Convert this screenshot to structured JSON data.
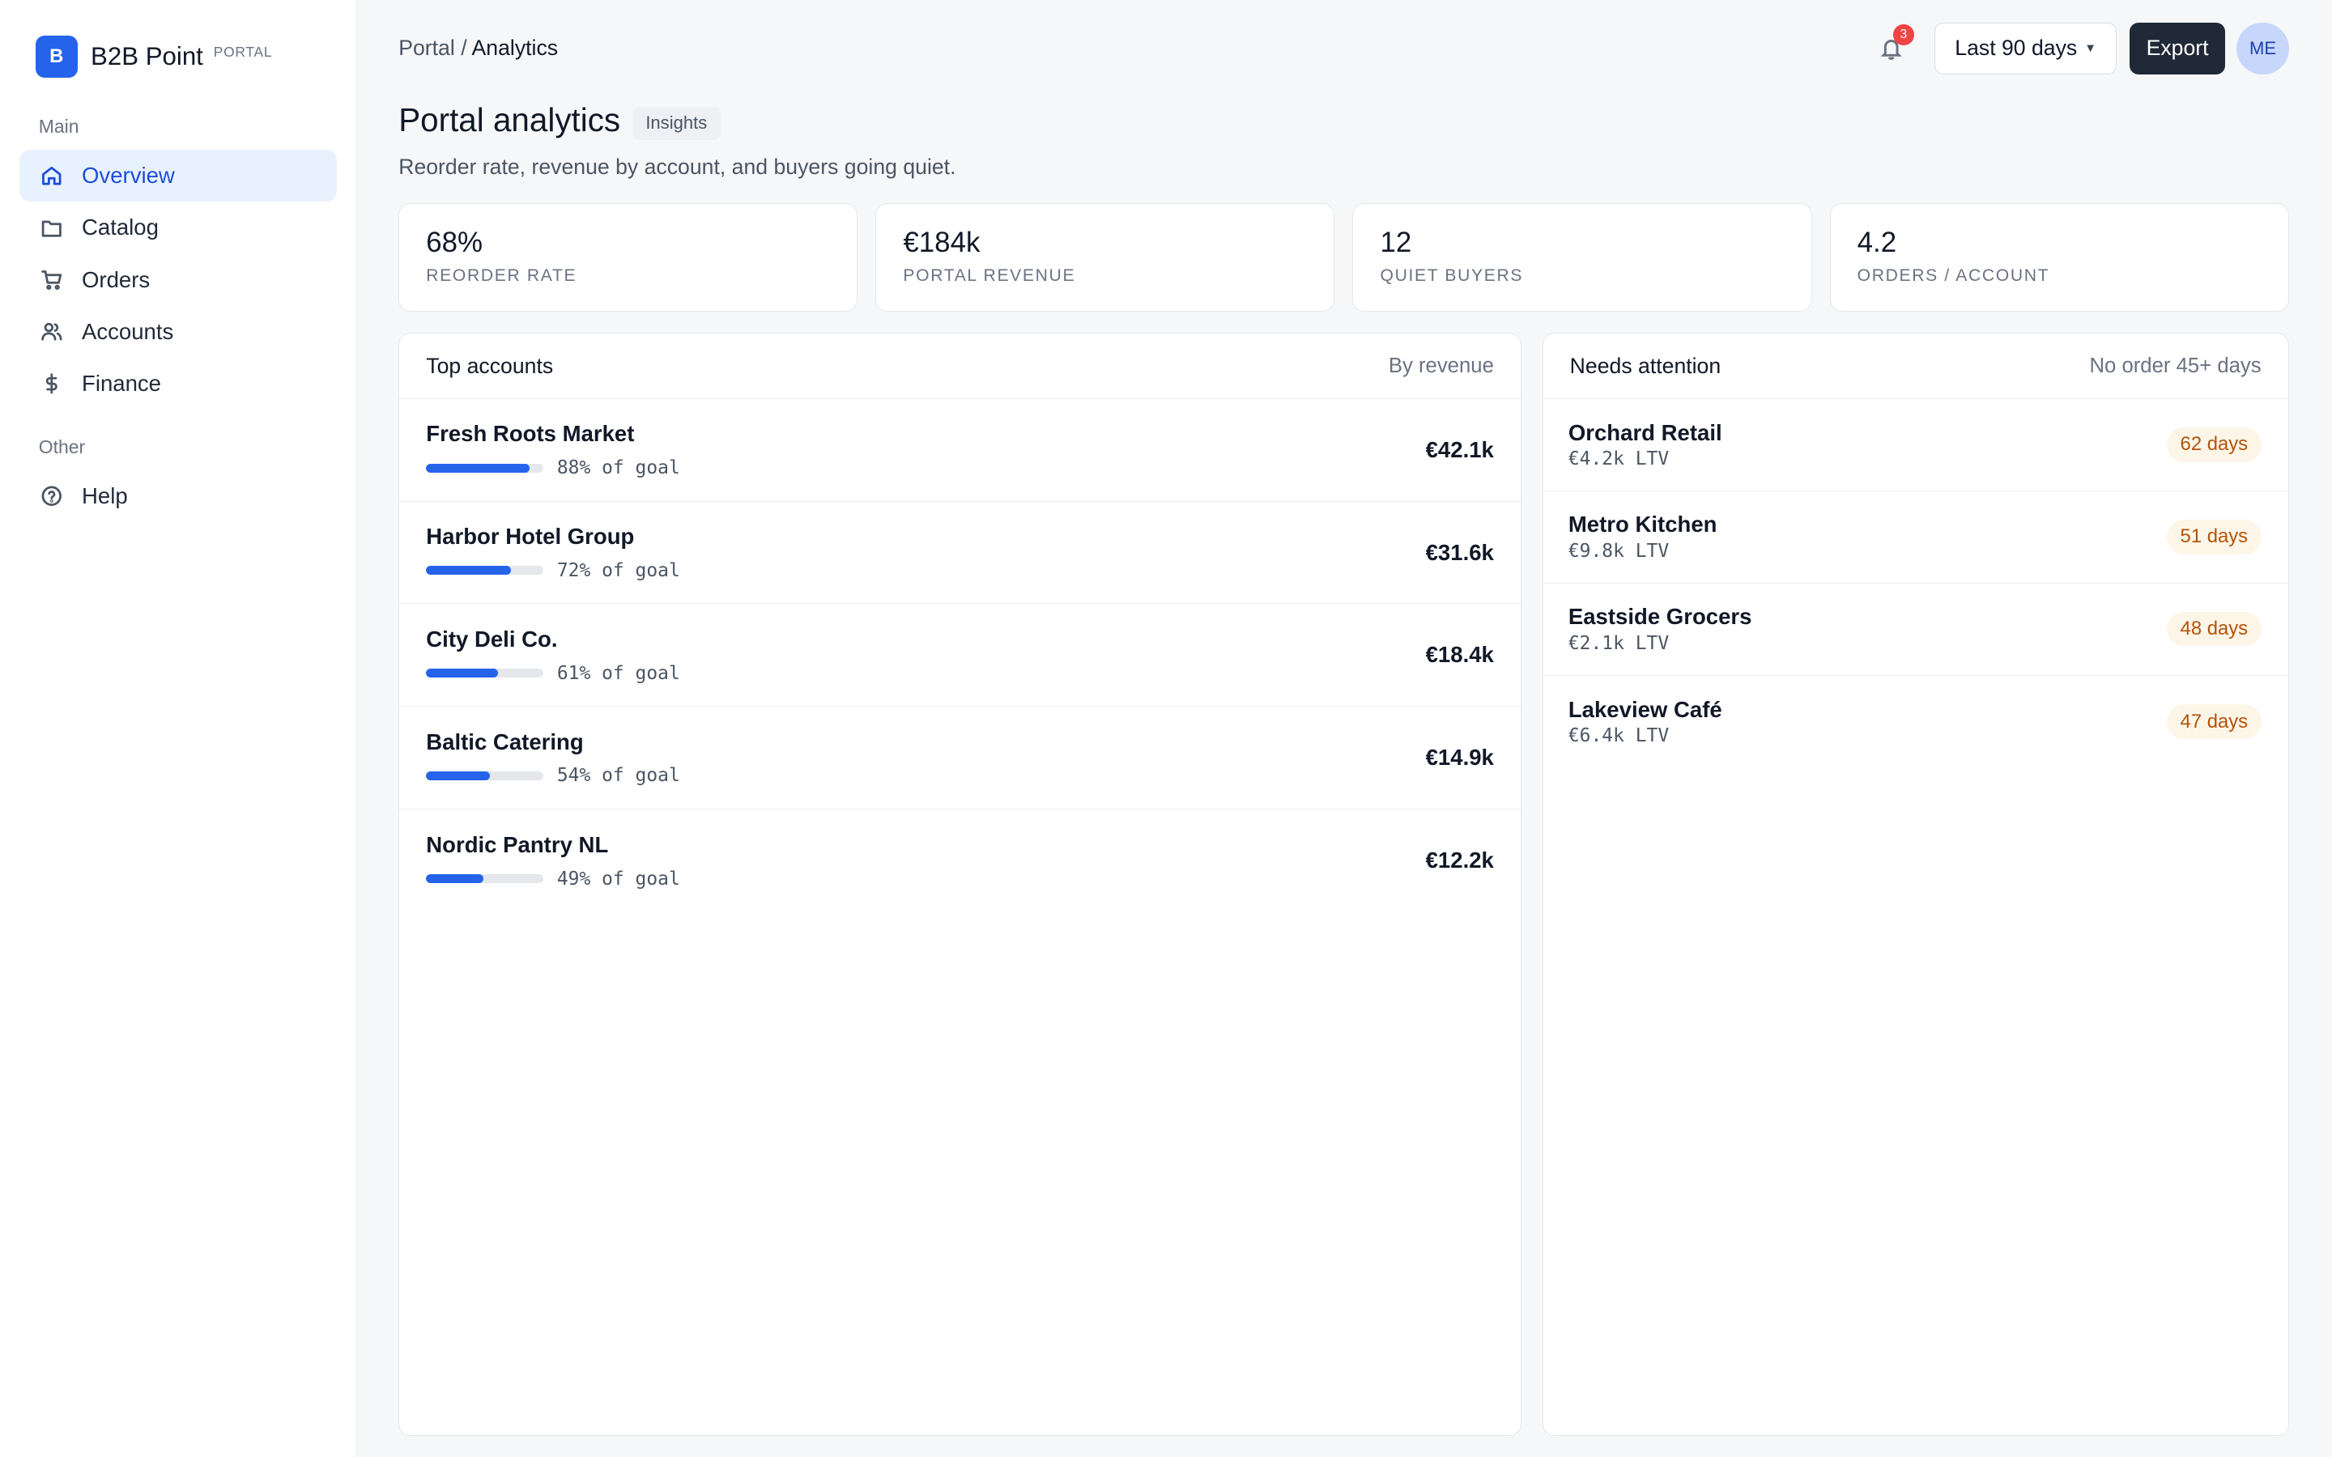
{
  "brand": {
    "logo_letter": "B",
    "name": "B2B Point",
    "tag": "PORTAL",
    "accent": "#2563eb"
  },
  "sidebar": {
    "section_main": "Main",
    "section_other": "Other",
    "items": [
      {
        "label": "Overview",
        "icon": "home-icon",
        "active": true
      },
      {
        "label": "Catalog",
        "icon": "folder-icon"
      },
      {
        "label": "Orders",
        "icon": "cart-icon"
      },
      {
        "label": "Accounts",
        "icon": "users-icon"
      },
      {
        "label": "Finance",
        "icon": "dollar-icon"
      }
    ],
    "other_items": [
      {
        "label": "Help",
        "icon": "help-icon"
      }
    ]
  },
  "header": {
    "breadcrumb_root": "Portal",
    "breadcrumb_sep": "/",
    "breadcrumb_current": "Analytics",
    "notification_count": "3",
    "range_label": "Last 90 days",
    "export_label": "Export",
    "avatar_initials": "ME"
  },
  "page": {
    "title": "Portal analytics",
    "chip": "Insights",
    "subtitle": "Reorder rate, revenue by account, and buyers going quiet."
  },
  "kpis": [
    {
      "value": "68%",
      "label": "REORDER RATE"
    },
    {
      "value": "€184k",
      "label": "PORTAL REVENUE"
    },
    {
      "value": "12",
      "label": "QUIET BUYERS"
    },
    {
      "value": "4.2",
      "label": "ORDERS / ACCOUNT"
    }
  ],
  "top_accounts": {
    "title": "Top accounts",
    "meta": "By revenue",
    "rows": [
      {
        "name": "Fresh Roots Market",
        "goal_pct": 88,
        "goal_text": "88% of goal",
        "value": "€42.1k"
      },
      {
        "name": "Harbor Hotel Group",
        "goal_pct": 72,
        "goal_text": "72% of goal",
        "value": "€31.6k"
      },
      {
        "name": "City Deli Co.",
        "goal_pct": 61,
        "goal_text": "61% of goal",
        "value": "€18.4k"
      },
      {
        "name": "Baltic Catering",
        "goal_pct": 54,
        "goal_text": "54% of goal",
        "value": "€14.9k"
      },
      {
        "name": "Nordic Pantry NL",
        "goal_pct": 49,
        "goal_text": "49% of goal",
        "value": "€12.2k"
      }
    ]
  },
  "attention": {
    "title": "Needs attention",
    "meta": "No order 45+ days",
    "rows": [
      {
        "name": "Orchard Retail",
        "ltv": "€4.2k LTV",
        "days": "62 days"
      },
      {
        "name": "Metro Kitchen",
        "ltv": "€9.8k LTV",
        "days": "51 days"
      },
      {
        "name": "Eastside Grocers",
        "ltv": "€2.1k LTV",
        "days": "48 days"
      },
      {
        "name": "Lakeview Café",
        "ltv": "€6.4k LTV",
        "days": "47 days"
      }
    ]
  }
}
